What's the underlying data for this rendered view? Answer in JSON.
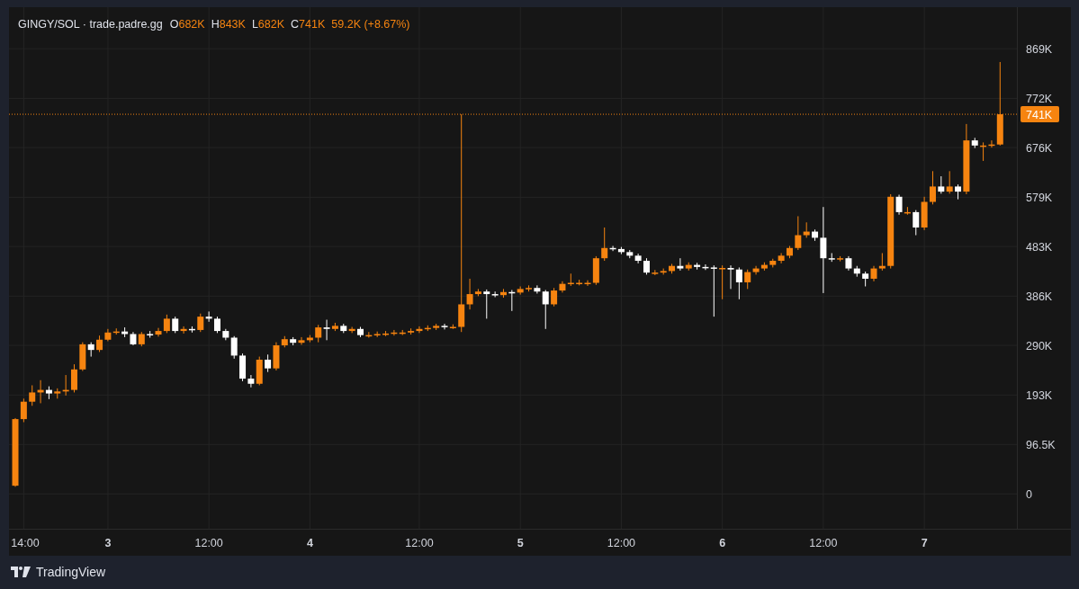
{
  "legend": {
    "symbol": "GINGY/SOL · trade.padre.gg",
    "ohlc": [
      {
        "label": "O",
        "value": "682K"
      },
      {
        "label": "H",
        "value": "843K"
      },
      {
        "label": "L",
        "value": "682K"
      },
      {
        "label": "C",
        "value": "741K"
      }
    ],
    "change": "59.2K (+8.67%)"
  },
  "chart": {
    "chart_data": {
      "type": "candlestick",
      "grid": true,
      "ylim": [
        -68,
        950
      ],
      "yticks": [
        {
          "value": 0,
          "label": "0"
        },
        {
          "value": 96.5,
          "label": "96.5K"
        },
        {
          "value": 193,
          "label": "193K"
        },
        {
          "value": 290,
          "label": "290K"
        },
        {
          "value": 386,
          "label": "386K"
        },
        {
          "value": 483,
          "label": "483K"
        },
        {
          "value": 579,
          "label": "579K"
        },
        {
          "value": 676,
          "label": "676K"
        },
        {
          "value": 772,
          "label": "772K"
        },
        {
          "value": 869,
          "label": "869K"
        }
      ],
      "categories": [
        null,
        "14:00",
        null,
        null,
        null,
        null,
        null,
        null,
        null,
        null,
        null,
        "3",
        null,
        null,
        null,
        null,
        null,
        null,
        null,
        null,
        null,
        null,
        null,
        "12:00",
        null,
        null,
        null,
        null,
        null,
        null,
        null,
        null,
        null,
        null,
        null,
        "4",
        null,
        null,
        null,
        null,
        null,
        null,
        null,
        null,
        null,
        null,
        null,
        null,
        "12:00",
        null,
        null,
        null,
        null,
        null,
        null,
        null,
        null,
        null,
        null,
        null,
        "5",
        null,
        null,
        null,
        null,
        null,
        null,
        null,
        null,
        null,
        null,
        null,
        "12:00",
        null,
        null,
        null,
        null,
        null,
        null,
        null,
        null,
        null,
        null,
        null,
        "6",
        null,
        null,
        null,
        null,
        null,
        null,
        null,
        null,
        null,
        null,
        null,
        "12:00",
        null,
        null,
        null,
        null,
        null,
        null,
        null,
        null,
        null,
        null,
        null,
        "7",
        null,
        null,
        null,
        null,
        null,
        null,
        null,
        null,
        null
      ],
      "ref_lines": [
        {
          "axis": "y",
          "value": 741,
          "label": "741K"
        }
      ],
      "ohlc": [
        [
          16,
          148,
          14,
          146
        ],
        [
          146,
          186,
          140,
          180
        ],
        [
          180,
          212,
          172,
          198
        ],
        [
          198,
          222,
          177,
          203
        ],
        [
          203,
          210,
          185,
          196
        ],
        [
          196,
          206,
          186,
          200
        ],
        [
          200,
          232,
          192,
          203
        ],
        [
          203,
          253,
          198,
          243
        ],
        [
          243,
          296,
          240,
          292
        ],
        [
          292,
          296,
          268,
          281
        ],
        [
          281,
          309,
          277,
          301
        ],
        [
          301,
          322,
          298,
          315
        ],
        [
          315,
          323,
          311,
          317
        ],
        [
          317,
          325,
          306,
          312
        ],
        [
          312,
          316,
          290,
          292
        ],
        [
          292,
          316,
          288,
          312
        ],
        [
          312,
          318,
          305,
          311
        ],
        [
          311,
          324,
          307,
          318
        ],
        [
          318,
          350,
          314,
          342
        ],
        [
          342,
          346,
          314,
          318
        ],
        [
          318,
          327,
          313,
          322
        ],
        [
          322,
          327,
          315,
          320
        ],
        [
          320,
          352,
          316,
          346
        ],
        [
          346,
          356,
          336,
          342
        ],
        [
          342,
          346,
          314,
          318
        ],
        [
          318,
          322,
          300,
          305
        ],
        [
          305,
          308,
          264,
          270
        ],
        [
          270,
          274,
          220,
          225
        ],
        [
          225,
          232,
          208,
          215
        ],
        [
          215,
          268,
          212,
          262
        ],
        [
          262,
          272,
          238,
          245
        ],
        [
          245,
          296,
          241,
          290
        ],
        [
          290,
          308,
          286,
          302
        ],
        [
          302,
          306,
          290,
          295
        ],
        [
          295,
          306,
          291,
          300
        ],
        [
          300,
          310,
          296,
          305
        ],
        [
          305,
          330,
          296,
          325
        ],
        [
          325,
          340,
          300,
          322
        ],
        [
          322,
          334,
          318,
          328
        ],
        [
          328,
          332,
          314,
          318
        ],
        [
          318,
          326,
          314,
          322
        ],
        [
          322,
          326,
          306,
          310
        ],
        [
          310,
          316,
          305,
          310
        ],
        [
          310,
          317,
          306,
          312
        ],
        [
          312,
          318,
          308,
          313
        ],
        [
          313,
          320,
          309,
          315
        ],
        [
          315,
          320,
          310,
          315
        ],
        [
          315,
          323,
          311,
          318
        ],
        [
          318,
          327,
          314,
          322
        ],
        [
          322,
          329,
          318,
          324
        ],
        [
          324,
          332,
          320,
          328
        ],
        [
          328,
          332,
          321,
          326
        ],
        [
          326,
          331,
          322,
          326
        ],
        [
          326,
          741,
          316,
          370
        ],
        [
          370,
          420,
          360,
          390
        ],
        [
          390,
          400,
          386,
          395
        ],
        [
          395,
          399,
          342,
          390
        ],
        [
          390,
          395,
          384,
          388
        ],
        [
          388,
          400,
          383,
          394
        ],
        [
          394,
          398,
          357,
          393
        ],
        [
          393,
          405,
          389,
          400
        ],
        [
          400,
          407,
          395,
          402
        ],
        [
          402,
          407,
          391,
          395
        ],
        [
          395,
          398,
          322,
          370
        ],
        [
          370,
          402,
          366,
          397
        ],
        [
          397,
          415,
          393,
          410
        ],
        [
          410,
          430,
          406,
          412
        ],
        [
          412,
          418,
          407,
          412
        ],
        [
          412,
          417,
          406,
          412
        ],
        [
          412,
          464,
          408,
          460
        ],
        [
          460,
          520,
          455,
          480
        ],
        [
          480,
          484,
          474,
          478
        ],
        [
          478,
          482,
          468,
          472
        ],
        [
          472,
          476,
          460,
          465
        ],
        [
          465,
          469,
          450,
          455
        ],
        [
          455,
          460,
          428,
          432
        ],
        [
          432,
          437,
          427,
          432
        ],
        [
          432,
          440,
          428,
          435
        ],
        [
          435,
          449,
          430,
          445
        ],
        [
          445,
          460,
          436,
          440
        ],
        [
          440,
          452,
          436,
          447
        ],
        [
          447,
          451,
          438,
          443
        ],
        [
          443,
          448,
          437,
          442
        ],
        [
          442,
          446,
          346,
          440
        ],
        [
          440,
          446,
          380,
          441
        ],
        [
          441,
          446,
          400,
          438
        ],
        [
          438,
          442,
          380,
          413
        ],
        [
          413,
          438,
          400,
          433
        ],
        [
          433,
          445,
          428,
          440
        ],
        [
          440,
          452,
          436,
          447
        ],
        [
          447,
          459,
          442,
          455
        ],
        [
          455,
          470,
          450,
          465
        ],
        [
          465,
          484,
          460,
          480
        ],
        [
          480,
          542,
          476,
          505
        ],
        [
          505,
          530,
          500,
          512
        ],
        [
          512,
          516,
          494,
          500
        ],
        [
          500,
          560,
          392,
          460
        ],
        [
          460,
          470,
          453,
          458
        ],
        [
          458,
          464,
          454,
          460
        ],
        [
          460,
          464,
          436,
          440
        ],
        [
          440,
          445,
          424,
          430
        ],
        [
          430,
          434,
          405,
          420
        ],
        [
          420,
          445,
          415,
          440
        ],
        [
          440,
          470,
          436,
          445
        ],
        [
          445,
          585,
          440,
          580
        ],
        [
          580,
          584,
          545,
          550
        ],
        [
          550,
          560,
          545,
          550
        ],
        [
          550,
          554,
          505,
          520
        ],
        [
          520,
          580,
          515,
          570
        ],
        [
          570,
          630,
          565,
          600
        ],
        [
          600,
          620,
          586,
          590
        ],
        [
          590,
          630,
          586,
          600
        ],
        [
          600,
          604,
          575,
          590
        ],
        [
          590,
          722,
          585,
          690
        ],
        [
          690,
          695,
          675,
          680
        ],
        [
          680,
          686,
          650,
          680
        ],
        [
          680,
          690,
          676,
          682
        ],
        [
          682,
          843,
          680,
          741
        ]
      ]
    }
  },
  "footer": {
    "brand": "TradingView"
  }
}
